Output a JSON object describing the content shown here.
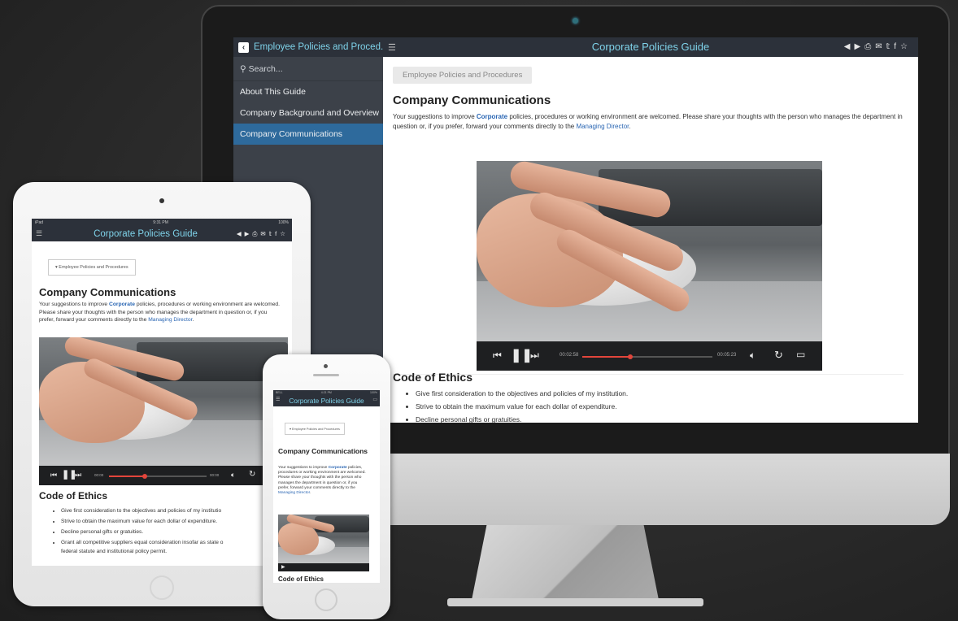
{
  "desktop": {
    "sidebar_header": "Employee Policies and Proced...",
    "search_placeholder": "Search...",
    "nav_items": [
      "About This Guide",
      "Company Background and Overview",
      "Company Communications"
    ],
    "app_title": "Corporate Policies Guide",
    "breadcrumb": "Employee Policies and Procedures",
    "heading": "Company Communications",
    "intro_pre": "Your suggestions to improve ",
    "intro_link1": "Corporate",
    "intro_mid": " policies, procedures or working environment are welcomed. Please share your thoughts with the person who manages the department in question or, if you prefer, forward your comments directly to the ",
    "intro_link2": "Managing Director",
    "intro_end": ".",
    "video": {
      "time_elapsed": "00:02:58",
      "time_total": "00:05:23",
      "progress": 0.37
    },
    "ethics_heading": "Code of Ethics",
    "ethics_items": [
      "Give first consideration to the objectives and policies of my institution.",
      "Strive to obtain the maximum value for each dollar of expenditure.",
      "Decline personal gifts or gratuities."
    ]
  },
  "tablet": {
    "status_left": "iPad",
    "status_time": "9:31 PM",
    "status_battery": "100%",
    "app_title": "Corporate Policies Guide",
    "breadcrumb": "Employee Policies and Procedures",
    "heading": "Company Communications",
    "intro_pre": "Your suggestions to improve ",
    "intro_link1": "Corporate",
    "intro_mid": " policies, procedures or working environment are welcomed. Please share your thoughts with the person who manages the department in question or, if you prefer, forward your comments directly to the ",
    "intro_link2": "Managing Director",
    "intro_end": ".",
    "video": {
      "time_elapsed": "00:00",
      "time_total": "00:00",
      "progress": 0.37
    },
    "ethics_heading": "Code of Ethics",
    "ethics_items": [
      "Give first consideration to the objectives and policies of my institutio",
      "Strive to obtain the maximum value for each dollar of expenditure.",
      "Decline personal gifts or gratuities.",
      "Grant all competitive suppliers equal consideration insofar as state o",
      "federal statute and institutional policy permit."
    ]
  },
  "phone": {
    "status_left": "BELL",
    "status_time": "4:21 PM",
    "status_battery": "100%",
    "app_title": "Corporate Policies Guide",
    "breadcrumb": "Employee Policies and Procedures",
    "heading": "Company Communications",
    "intro_pre": "Your suggestions to improve ",
    "intro_link1": "Corporate",
    "intro_mid": " policies, procedures or working environment are welcomed. Please share your thoughts with the person who manages the department in question or, if you prefer, forward your comments directly to the ",
    "intro_link2": "Managing Director",
    "intro_end": ".",
    "ethics_heading": "Code of Ethics"
  },
  "toolbar_icons": [
    "prev-icon",
    "next-icon",
    "print-icon",
    "email-icon",
    "twitter-icon",
    "facebook-icon",
    "star-icon"
  ],
  "colors": {
    "title_cyan": "#7fd3ea",
    "active_blue": "#2e6a9c",
    "link_blue": "#2a66b3",
    "progress_red": "#e2453b",
    "topbar": "#2c313a"
  }
}
